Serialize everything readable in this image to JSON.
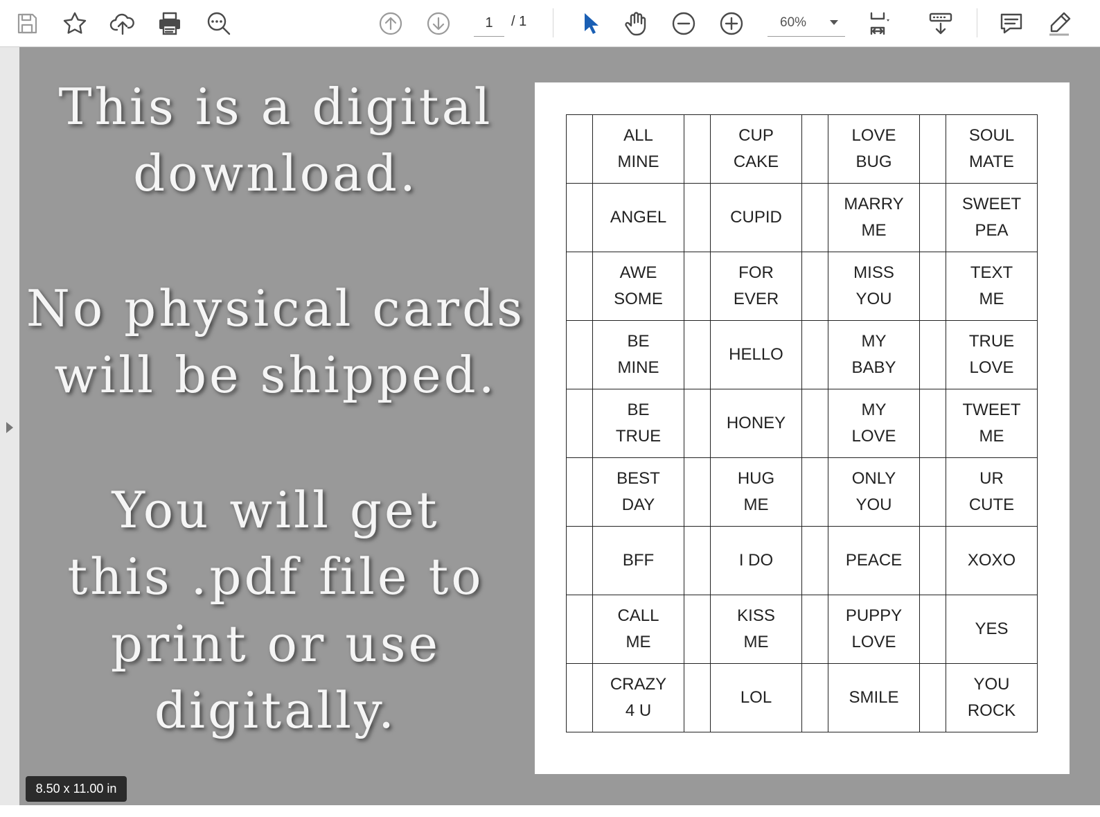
{
  "toolbar": {
    "page_current": "1",
    "page_total": "/ 1",
    "zoom": "60%",
    "icons": [
      "save-icon",
      "bookmark-star-icon",
      "cloud-upload-icon",
      "print-icon",
      "search-zoom-icon",
      "page-up-icon",
      "page-down-icon",
      "select-cursor-icon",
      "hand-tool-icon",
      "zoom-out-icon",
      "zoom-in-icon",
      "page-fit-icon",
      "scroll-mode-icon",
      "comment-icon",
      "pen-icon"
    ]
  },
  "colors": {
    "viewer_bg": "#999999",
    "promo_text": "#f5f5f5",
    "cursor_blue": "#1a5fb4"
  },
  "promo": {
    "lines": [
      "This is a digital",
      "download.",
      "No physical cards",
      "will be shipped.",
      "You will get",
      "this .pdf file to",
      "print or use",
      "digitally."
    ]
  },
  "grid": {
    "rows": [
      [
        [
          "ALL",
          "MINE"
        ],
        [
          "CUP",
          "CAKE"
        ],
        [
          "LOVE",
          "BUG"
        ],
        [
          "SOUL",
          "MATE"
        ]
      ],
      [
        [
          "ANGEL"
        ],
        [
          "CUPID"
        ],
        [
          "MARRY",
          "ME"
        ],
        [
          "SWEET",
          "PEA"
        ]
      ],
      [
        [
          "AWE",
          "SOME"
        ],
        [
          "FOR",
          "EVER"
        ],
        [
          "MISS",
          "YOU"
        ],
        [
          "TEXT",
          "ME"
        ]
      ],
      [
        [
          "BE",
          "MINE"
        ],
        [
          "HELLO"
        ],
        [
          "MY",
          "BABY"
        ],
        [
          "TRUE",
          "LOVE"
        ]
      ],
      [
        [
          "BE",
          "TRUE"
        ],
        [
          "HONEY"
        ],
        [
          "MY",
          "LOVE"
        ],
        [
          "TWEET",
          "ME"
        ]
      ],
      [
        [
          "BEST",
          "DAY"
        ],
        [
          "HUG",
          "ME"
        ],
        [
          "ONLY",
          "YOU"
        ],
        [
          "UR",
          "CUTE"
        ]
      ],
      [
        [
          "BFF"
        ],
        [
          "I DO"
        ],
        [
          "PEACE"
        ],
        [
          "XOXO"
        ]
      ],
      [
        [
          "CALL",
          "ME"
        ],
        [
          "KISS",
          "ME"
        ],
        [
          "PUPPY",
          "LOVE"
        ],
        [
          "YES"
        ]
      ],
      [
        [
          "CRAZY",
          "4 U"
        ],
        [
          "LOL"
        ],
        [
          "SMILE"
        ],
        [
          "YOU",
          "ROCK"
        ]
      ]
    ]
  },
  "status": {
    "page_size": "8.50 x 11.00 in"
  }
}
